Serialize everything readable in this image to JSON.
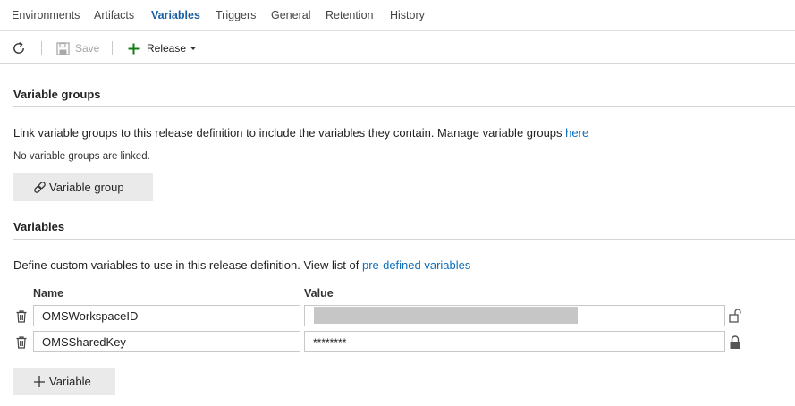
{
  "tabs": [
    {
      "label": "Environments"
    },
    {
      "label": "Artifacts"
    },
    {
      "label": "Variables"
    },
    {
      "label": "Triggers"
    },
    {
      "label": "General"
    },
    {
      "label": "Retention"
    },
    {
      "label": "History"
    }
  ],
  "active_tab": "Variables",
  "toolbar": {
    "refresh_icon": "refresh-icon",
    "save_label": "Save",
    "save_enabled": false,
    "release_label": "Release",
    "release_icon": "plus-icon"
  },
  "variable_groups": {
    "title": "Variable groups",
    "description": "Link variable groups to this release definition to include the variables they contain. Manage variable groups ",
    "description_link": "here",
    "empty_note": "No variable groups are linked.",
    "add_button_label": "Variable group",
    "add_button_icon": "link-icon"
  },
  "variables": {
    "title": "Variables",
    "description": "Define custom variables to use in this release definition. View list of ",
    "description_link": "pre-defined variables",
    "col_name": "Name",
    "col_value": "Value",
    "rows": [
      {
        "name": "OMSWorkspaceID",
        "value": "",
        "value_redacted": true,
        "secret": false,
        "lock_icon": "unlock-icon"
      },
      {
        "name": "OMSSharedKey",
        "value": "********",
        "value_redacted": false,
        "secret": true,
        "lock_icon": "lock-icon"
      }
    ],
    "add_button_label": "Variable",
    "add_button_icon": "plus-icon"
  },
  "colors": {
    "accent": "#1b5fa3",
    "link": "#106ebe",
    "add_green": "#107c10",
    "button_bg": "#eaeaea"
  }
}
